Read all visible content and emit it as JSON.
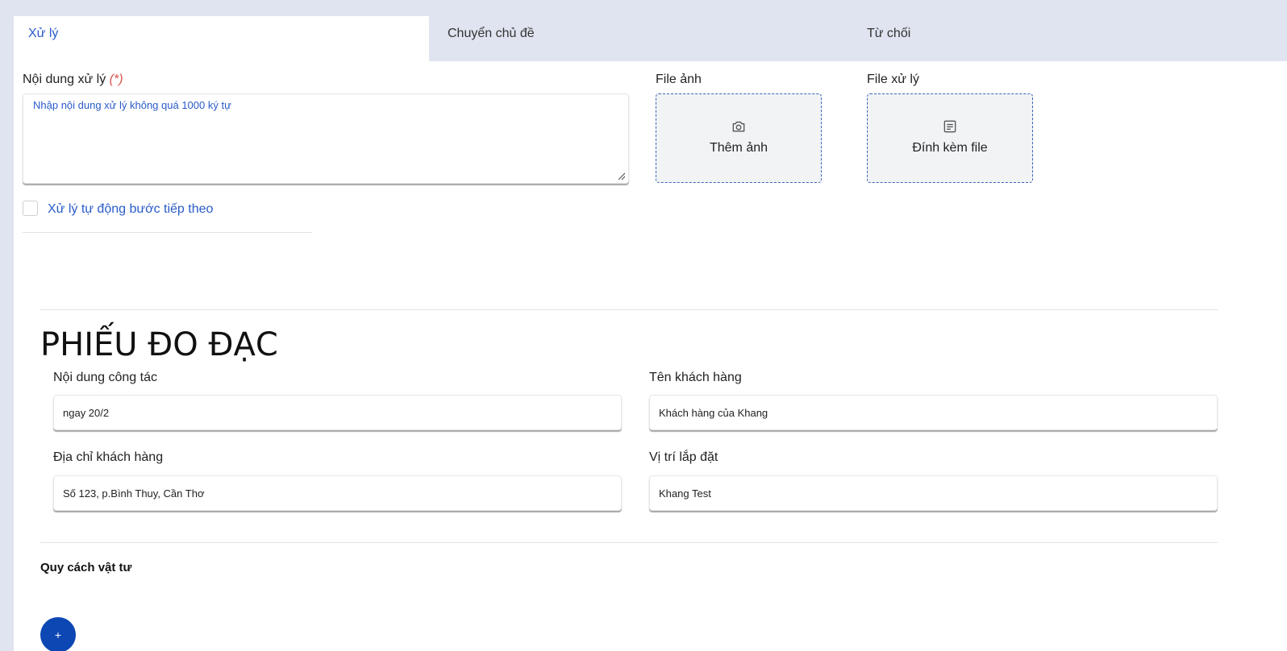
{
  "tabs": [
    {
      "label": "Xử lý",
      "active": true
    },
    {
      "label": "Chuyển chủ đề",
      "active": false
    },
    {
      "label": "Từ chối",
      "active": false
    }
  ],
  "processing": {
    "content_label": "Nội dung xử lý",
    "required_mark": "(*)",
    "content_placeholder": "Nhập nội dung xử lý không quá 1000 ký tự",
    "image_label": "File ảnh",
    "image_button": "Thêm ảnh",
    "file_label": "File xử lý",
    "file_button": "Đính kèm file",
    "auto_next_label": "Xử lý tự động bước tiếp theo",
    "auto_next_checked": false
  },
  "form": {
    "title": "PHIẾU ĐO ĐẠC",
    "fields": {
      "work_content": {
        "label": "Nội dung công tác",
        "value": "ngay 20/2"
      },
      "customer_name": {
        "label": "Tên khách hàng",
        "value": "Khách hàng của Khang"
      },
      "customer_address": {
        "label": "Địa chỉ khách hàng",
        "value": "Số 123, p.Bình Thuy, Cần Thơ"
      },
      "install_location": {
        "label": "Vị trí lắp đặt",
        "value": "Khang Test"
      }
    },
    "materials_title": "Quy cách vật tư",
    "add_button": "+"
  },
  "colors": {
    "accent": "#2a5bc9",
    "tab_bar": "#dfe4f0",
    "fab": "#0d47b3",
    "required": "#d9534f"
  },
  "icons": {
    "image_upload": "camera-icon",
    "file_upload": "document-icon"
  }
}
